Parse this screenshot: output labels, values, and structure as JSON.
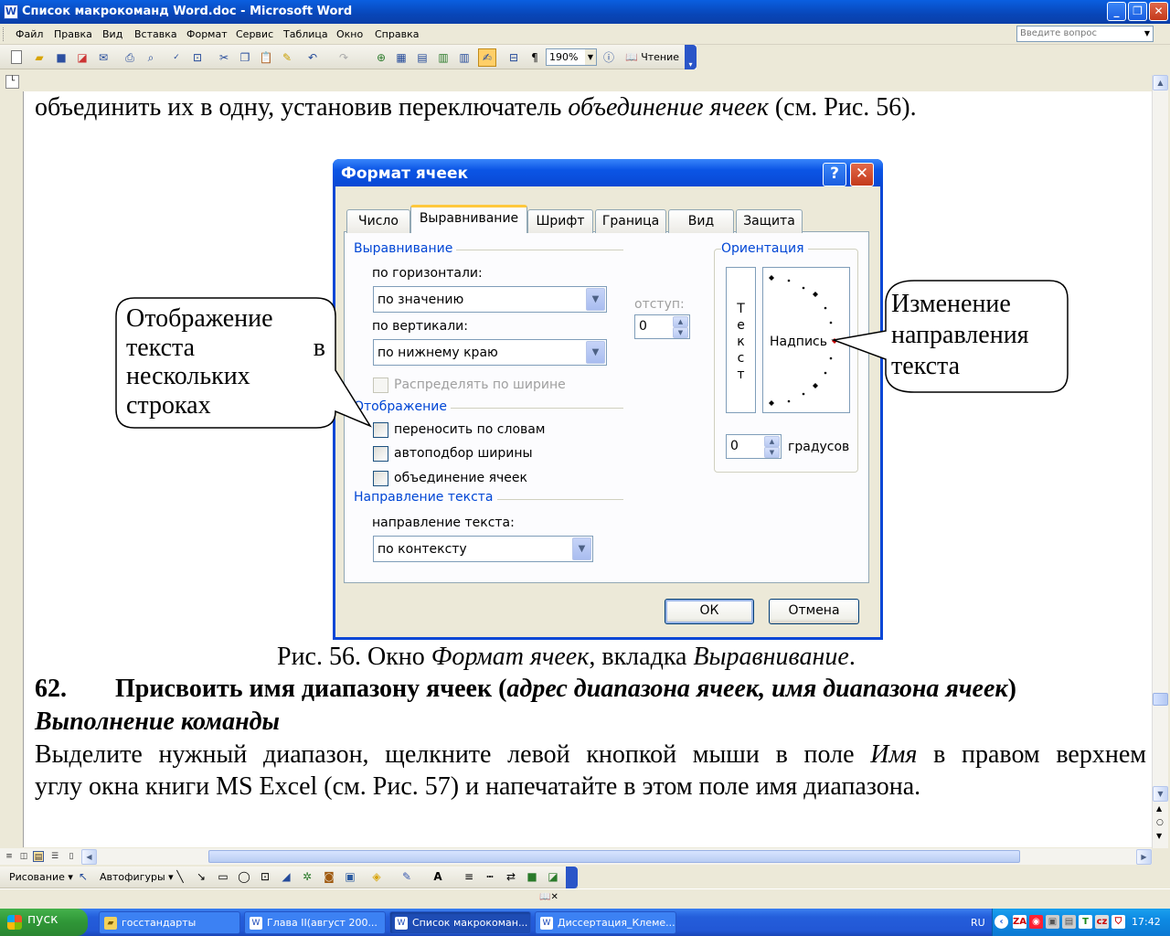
{
  "window": {
    "title": "Список макрокоманд Word.doc - Microsoft Word",
    "app_icon": "W",
    "min": "_",
    "max": "❐",
    "close": "✕"
  },
  "menu": [
    "Файл",
    "Правка",
    "Вид",
    "Вставка",
    "Формат",
    "Сервис",
    "Таблица",
    "Окно",
    "Справка"
  ],
  "ask_placeholder": "Введите вопрос",
  "toolbar": {
    "zoom": "190%",
    "read_label": "Чтение",
    "pilcrow": "¶"
  },
  "document": {
    "line1_a": "объединить их в одну, установив переключатель ",
    "line1_b": "объединение ячеек",
    "line1_c": " (см. Рис. 56).",
    "caption_a": "Рис. 56. Окно ",
    "caption_b": "Формат ячеек",
    "caption_c": ", вкладка ",
    "caption_d": "Выравнивание",
    "caption_e": ".",
    "heading_num": "62.",
    "heading_a": "Присвоить имя диапазону ячеек (",
    "heading_b": "адрес диапазона ячеек, имя диапазона ячеек",
    "heading_c": ")",
    "subheading": "Выполнение команды",
    "para1_a": "Выделите нужный диапазон, щелкните левой кнопкой мыши в поле ",
    "para1_b": "Имя",
    "para1_c": " в правом верхнем",
    "para2": "углу окна книги MS Excel (см. Рис. 57) и напечатайте в этом поле имя диапазона."
  },
  "dialog": {
    "title": "Формат ячеек",
    "help": "?",
    "close": "✕",
    "tabs": [
      "Число",
      "Выравнивание",
      "Шрифт",
      "Граница",
      "Вид",
      "Защита"
    ],
    "group_alignment": "Выравнивание",
    "horizontal_label": "по горизонтали:",
    "horizontal_value": "по значению",
    "vertical_label": "по вертикали:",
    "vertical_value": "по нижнему краю",
    "indent_label": "отступ:",
    "indent_value": "0",
    "distribute_label": "Распределять по ширине",
    "group_display": "Отображение",
    "wrap_label": "переносить по словам",
    "autofit_label": "автоподбор ширины",
    "merge_label": "объединение ячеек",
    "group_direction": "Направление текста",
    "direction_label": "направление текста:",
    "direction_value": "по контексту",
    "group_orientation": "Ориентация",
    "vertical_text": [
      "Т",
      "е",
      "к",
      "с",
      "т"
    ],
    "inscription": "Надпись",
    "degrees_value": "0",
    "degrees_label": "градусов",
    "ok": "ОК",
    "cancel": "Отмена"
  },
  "callouts": {
    "left": [
      "Отображение",
      "текста",
      "в",
      "нескольких",
      "строках"
    ],
    "right": [
      "Изменение",
      "направления",
      "текста"
    ]
  },
  "drawing_toolbar": {
    "draw": "Рисование ▾",
    "autoshapes": "Автофигуры ▾"
  },
  "taskbar": {
    "start": "пуск",
    "tasks": [
      "госстандарты",
      "Глава II(август 200...",
      "Список макрокоман...",
      "Диссертация_Клеме..."
    ],
    "lang": "RU",
    "time": "17:42"
  },
  "colors": {
    "title_blue": "#0a48d4",
    "group_blue": "#0046d5",
    "taskbar_blue": "#245edb",
    "start_green": "#2f9637"
  }
}
